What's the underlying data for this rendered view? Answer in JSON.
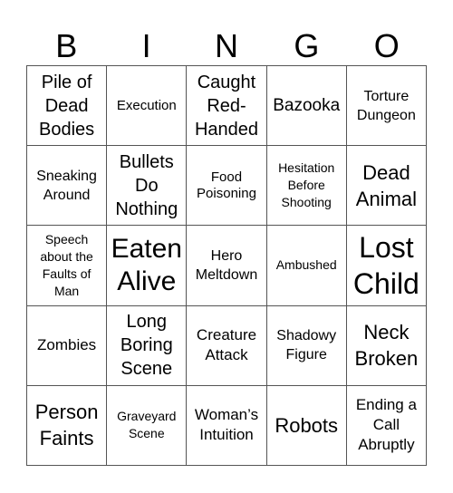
{
  "header": {
    "letters": [
      "B",
      "I",
      "N",
      "G",
      "O"
    ]
  },
  "card": {
    "rows": [
      [
        "Pile of Dead Bodies",
        "Execution",
        "Caught Red-Handed",
        "Bazooka",
        "Torture Dungeon"
      ],
      [
        "Sneaking Around",
        "Bullets Do Nothing",
        "Food Poisoning",
        "Hesitation Before Shooting",
        "Dead Animal"
      ],
      [
        "Speech about the Faults of Man",
        "Eaten Alive",
        "Hero Meltdown",
        "Ambushed",
        "Lost Child"
      ],
      [
        "Zombies",
        "Long Boring Scene",
        "Creature Attack",
        "Shadowy Figure",
        "Neck Broken"
      ],
      [
        "Person Faints",
        "Graveyard Scene",
        "Woman’s Intuition",
        "Robots",
        "Ending a Call Abruptly"
      ]
    ]
  }
}
